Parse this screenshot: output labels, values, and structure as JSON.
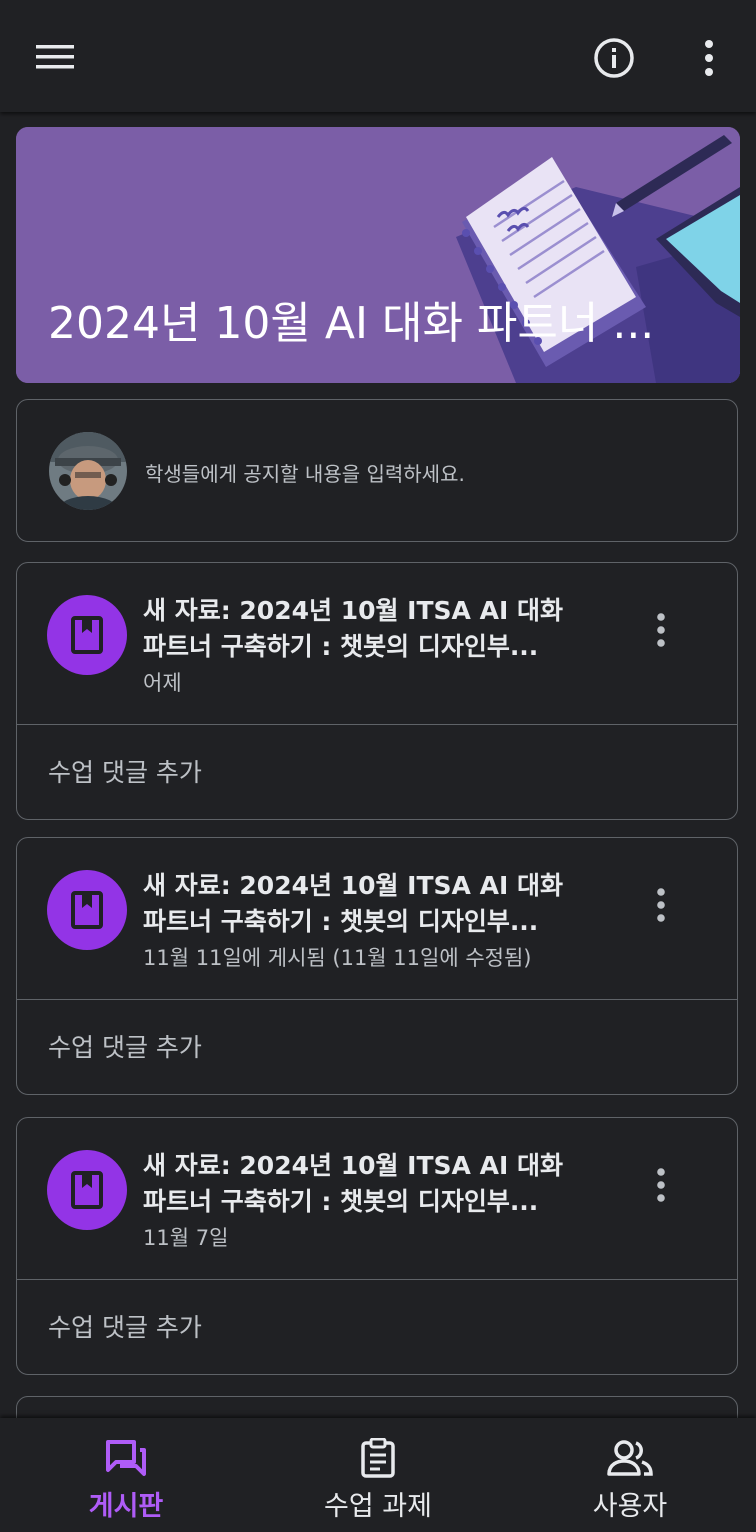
{
  "colors": {
    "background": "#202124",
    "accent": "#9334e6",
    "accent_text": "#af5cf7",
    "banner": "#7b5ea7",
    "border": "#5f6368"
  },
  "topbar": {
    "menu_icon": "menu-icon",
    "info_icon": "info-icon",
    "more_icon": "more-vert-icon"
  },
  "banner": {
    "title": "2024년 10월 AI 대화 파트너 ..."
  },
  "announce": {
    "placeholder": "학생들에게 공지할 내용을 입력하세요."
  },
  "posts": [
    {
      "title_line1": "새 자료: 2024년 10월 ITSA AI 대화",
      "title_line2": "파트너 구축하기 : 챗봇의 디자인부...",
      "date": "어제",
      "comment": "수업 댓글 추가",
      "icon": "book-icon"
    },
    {
      "title_line1": "새 자료: 2024년 10월 ITSA AI 대화",
      "title_line2": "파트너 구축하기 : 챗봇의 디자인부...",
      "date": "11월 11일에 게시됨 (11월 11일에 수정됨)",
      "comment": "수업 댓글 추가",
      "icon": "book-icon"
    },
    {
      "title_line1": "새 자료: 2024년 10월 ITSA AI 대화",
      "title_line2": "파트너 구축하기 : 챗봇의 디자인부...",
      "date": "11월 7일",
      "comment": "수업 댓글 추가",
      "icon": "book-icon"
    }
  ],
  "bottomnav": {
    "items": [
      {
        "label": "게시판",
        "icon": "stream-icon",
        "active": true
      },
      {
        "label": "수업 과제",
        "icon": "classwork-icon",
        "active": false
      },
      {
        "label": "사용자",
        "icon": "people-icon",
        "active": false
      }
    ]
  }
}
